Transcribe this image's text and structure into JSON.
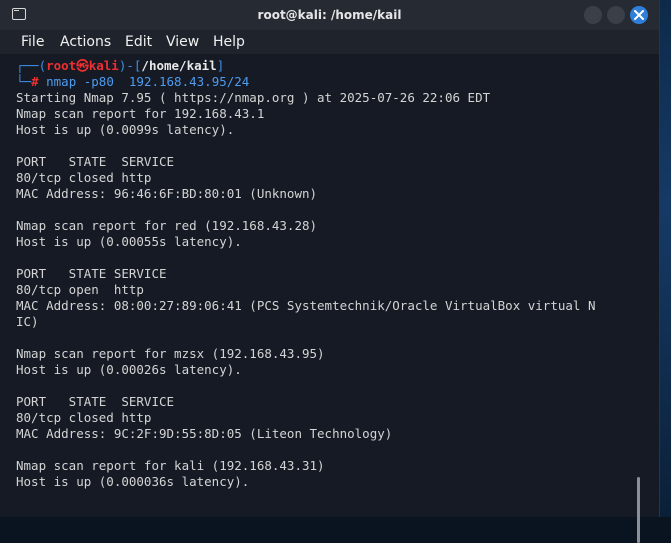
{
  "window": {
    "title": "root@kali: /home/kail"
  },
  "menu": [
    "File",
    "Actions",
    "Edit",
    "View",
    "Help"
  ],
  "prompt": {
    "open": "┌──(",
    "user": "root",
    "at": "㉿",
    "host": "kali",
    "mid": ")-[",
    "path": "/home/kail",
    "close": "]",
    "line2": "└─",
    "hash": "#",
    "command": "nmap -p80  192.168.43.95/24"
  },
  "output": [
    "Starting Nmap 7.95 ( https://nmap.org ) at 2025-07-26 22:06 EDT",
    "Nmap scan report for 192.168.43.1",
    "Host is up (0.0099s latency).",
    "",
    "PORT   STATE  SERVICE",
    "80/tcp closed http",
    "MAC Address: 96:46:6F:BD:80:01 (Unknown)",
    "",
    "Nmap scan report for red (192.168.43.28)",
    "Host is up (0.00055s latency).",
    "",
    "PORT   STATE SERVICE",
    "80/tcp open  http",
    "MAC Address: 08:00:27:89:06:41 (PCS Systemtechnik/Oracle VirtualBox virtual N",
    "IC)",
    "",
    "Nmap scan report for mzsx (192.168.43.95)",
    "Host is up (0.00026s latency).",
    "",
    "PORT   STATE  SERVICE",
    "80/tcp closed http",
    "MAC Address: 9C:2F:9D:55:8D:05 (Liteon Technology)",
    "",
    "Nmap scan report for kali (192.168.43.31)",
    "Host is up (0.000036s latency)."
  ]
}
